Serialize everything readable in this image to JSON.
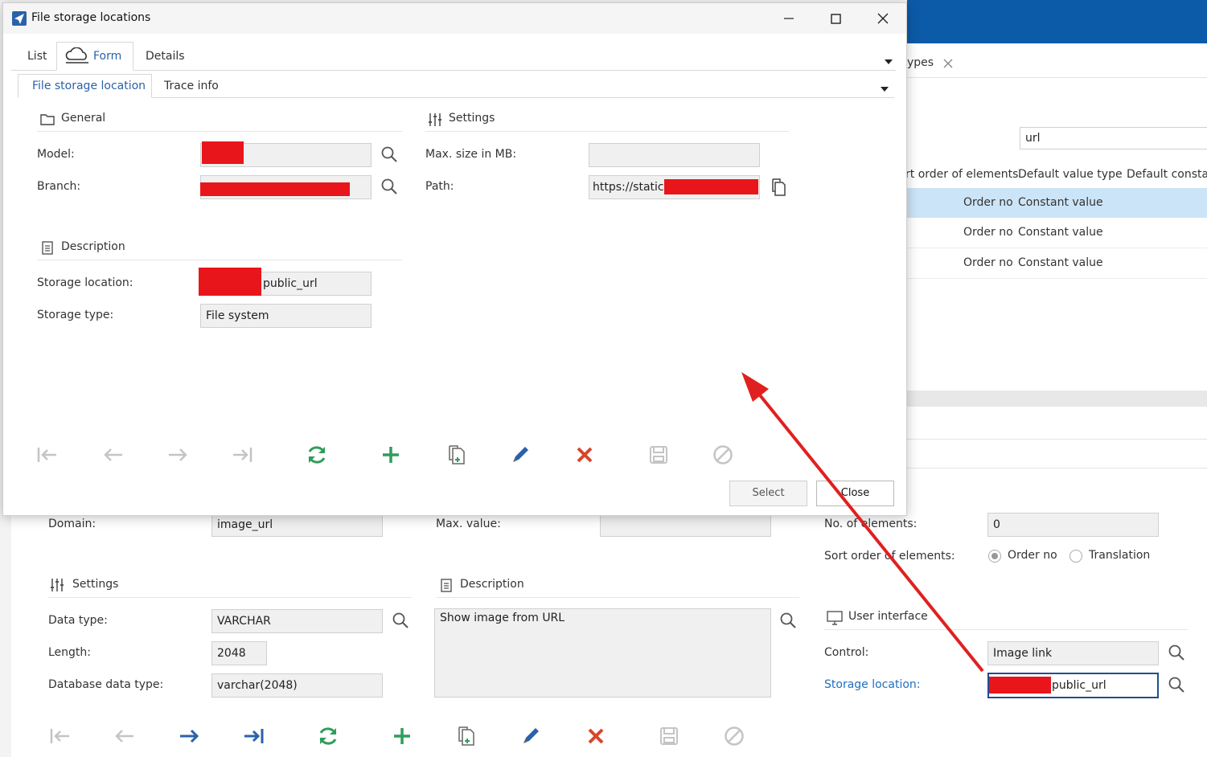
{
  "dialog": {
    "title": "File storage locations",
    "tabs": [
      "List",
      "Form",
      "Details"
    ],
    "subtabs": [
      "File storage location",
      "Trace info"
    ],
    "general": {
      "header": "General",
      "model_label": "Model:",
      "branch_label": "Branch:"
    },
    "settings": {
      "header": "Settings",
      "max_size_label": "Max. size in MB:",
      "max_size_value": "",
      "path_label": "Path:",
      "path_value": "https://static."
    },
    "description": {
      "header": "Description",
      "storage_location_label": "Storage location:",
      "storage_location_value": "public_url",
      "storage_type_label": "Storage type:",
      "storage_type_value": "File system"
    },
    "select_button": "Select",
    "close_button": "Close"
  },
  "background": {
    "tab_fragment": "ypes",
    "search_value": "url",
    "grid": {
      "headers": [
        "rt order of elements",
        "Default value type",
        "Default constar"
      ],
      "rows": [
        [
          "Order no",
          "Constant value"
        ],
        [
          "Order no",
          "Constant value"
        ],
        [
          "Order no",
          "Constant value"
        ]
      ]
    },
    "domain_label": "Domain:",
    "domain_value": "image_url",
    "max_value_label": "Max. value:",
    "max_value_value": "",
    "no_elements_label": "No. of elements:",
    "no_elements_value": "0",
    "sort_order_label": "Sort order of elements:",
    "sort_options": [
      "Order no",
      "Translation"
    ],
    "settings_header": "Settings",
    "description_header": "Description",
    "data_type_label": "Data type:",
    "data_type_value": "VARCHAR",
    "length_label": "Length:",
    "length_value": "2048",
    "db_type_label": "Database data type:",
    "db_type_value": "varchar(2048)",
    "description_text": "Show image from URL",
    "ui_header": "User interface",
    "control_label": "Control:",
    "control_value": "Image link",
    "storage_location_label": "Storage location:",
    "storage_location_value": "public_url"
  },
  "colors": {
    "accent_blue": "#2a62a9",
    "dark_blue_bar": "#0c5ba8",
    "selected_row": "#cce4f7",
    "redaction": "#e8161b",
    "arrow": "#e02020",
    "green": "#2e9e5b",
    "delete_red": "#d9452b"
  }
}
